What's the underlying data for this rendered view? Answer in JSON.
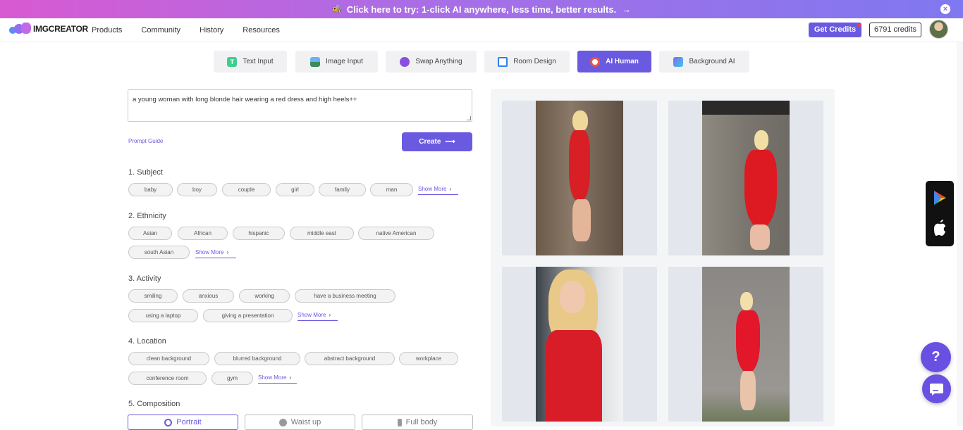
{
  "banner": {
    "text": "Click here to try: 1-click AI anywhere, less time, better results.",
    "arrow": "→",
    "close": "×"
  },
  "brand": {
    "name": "IMGCREATOR",
    "accent": "#6a5ae0"
  },
  "nav": {
    "items": [
      "Products",
      "Community",
      "History",
      "Resources"
    ]
  },
  "account": {
    "get_credits": "Get Credits",
    "credits": "6791 credits"
  },
  "tabs": [
    {
      "label": "Text Input",
      "icon": "text-icon"
    },
    {
      "label": "Image Input",
      "icon": "image-icon"
    },
    {
      "label": "Swap Anything",
      "icon": "swap-icon"
    },
    {
      "label": "Room Design",
      "icon": "house-icon"
    },
    {
      "label": "AI Human",
      "icon": "face-icon",
      "active": true
    },
    {
      "label": "Background AI",
      "icon": "landscape-icon"
    }
  ],
  "prompt": {
    "value": "a young woman with long blonde hair wearing a red dress and high heels++"
  },
  "prompt_guide": "Prompt Guide",
  "create": {
    "label": "Create",
    "arrow": "⟶"
  },
  "show_more": "Show More",
  "sections": {
    "subject": {
      "title": "1. Subject",
      "chips": [
        "baby",
        "boy",
        "couple",
        "girl",
        "family",
        "man"
      ]
    },
    "ethnicity": {
      "title": "2. Ethnicity",
      "chips": [
        "Asian",
        "African",
        "hispanic",
        "middle east",
        "native American",
        "south Asian"
      ]
    },
    "activity": {
      "title": "3. Activity",
      "chips": [
        "smiling",
        "anxious",
        "working",
        "have a business meeting",
        "using a laptop",
        "giving a presentation"
      ]
    },
    "location": {
      "title": "4. Location",
      "chips": [
        "clean background",
        "blurred background",
        "abstract background",
        "workplace",
        "conference room",
        "gym"
      ]
    },
    "composition": {
      "title": "5. Composition",
      "options": [
        "Portrait",
        "Waist up",
        "Full body"
      ]
    }
  },
  "help": {
    "label": "?"
  }
}
